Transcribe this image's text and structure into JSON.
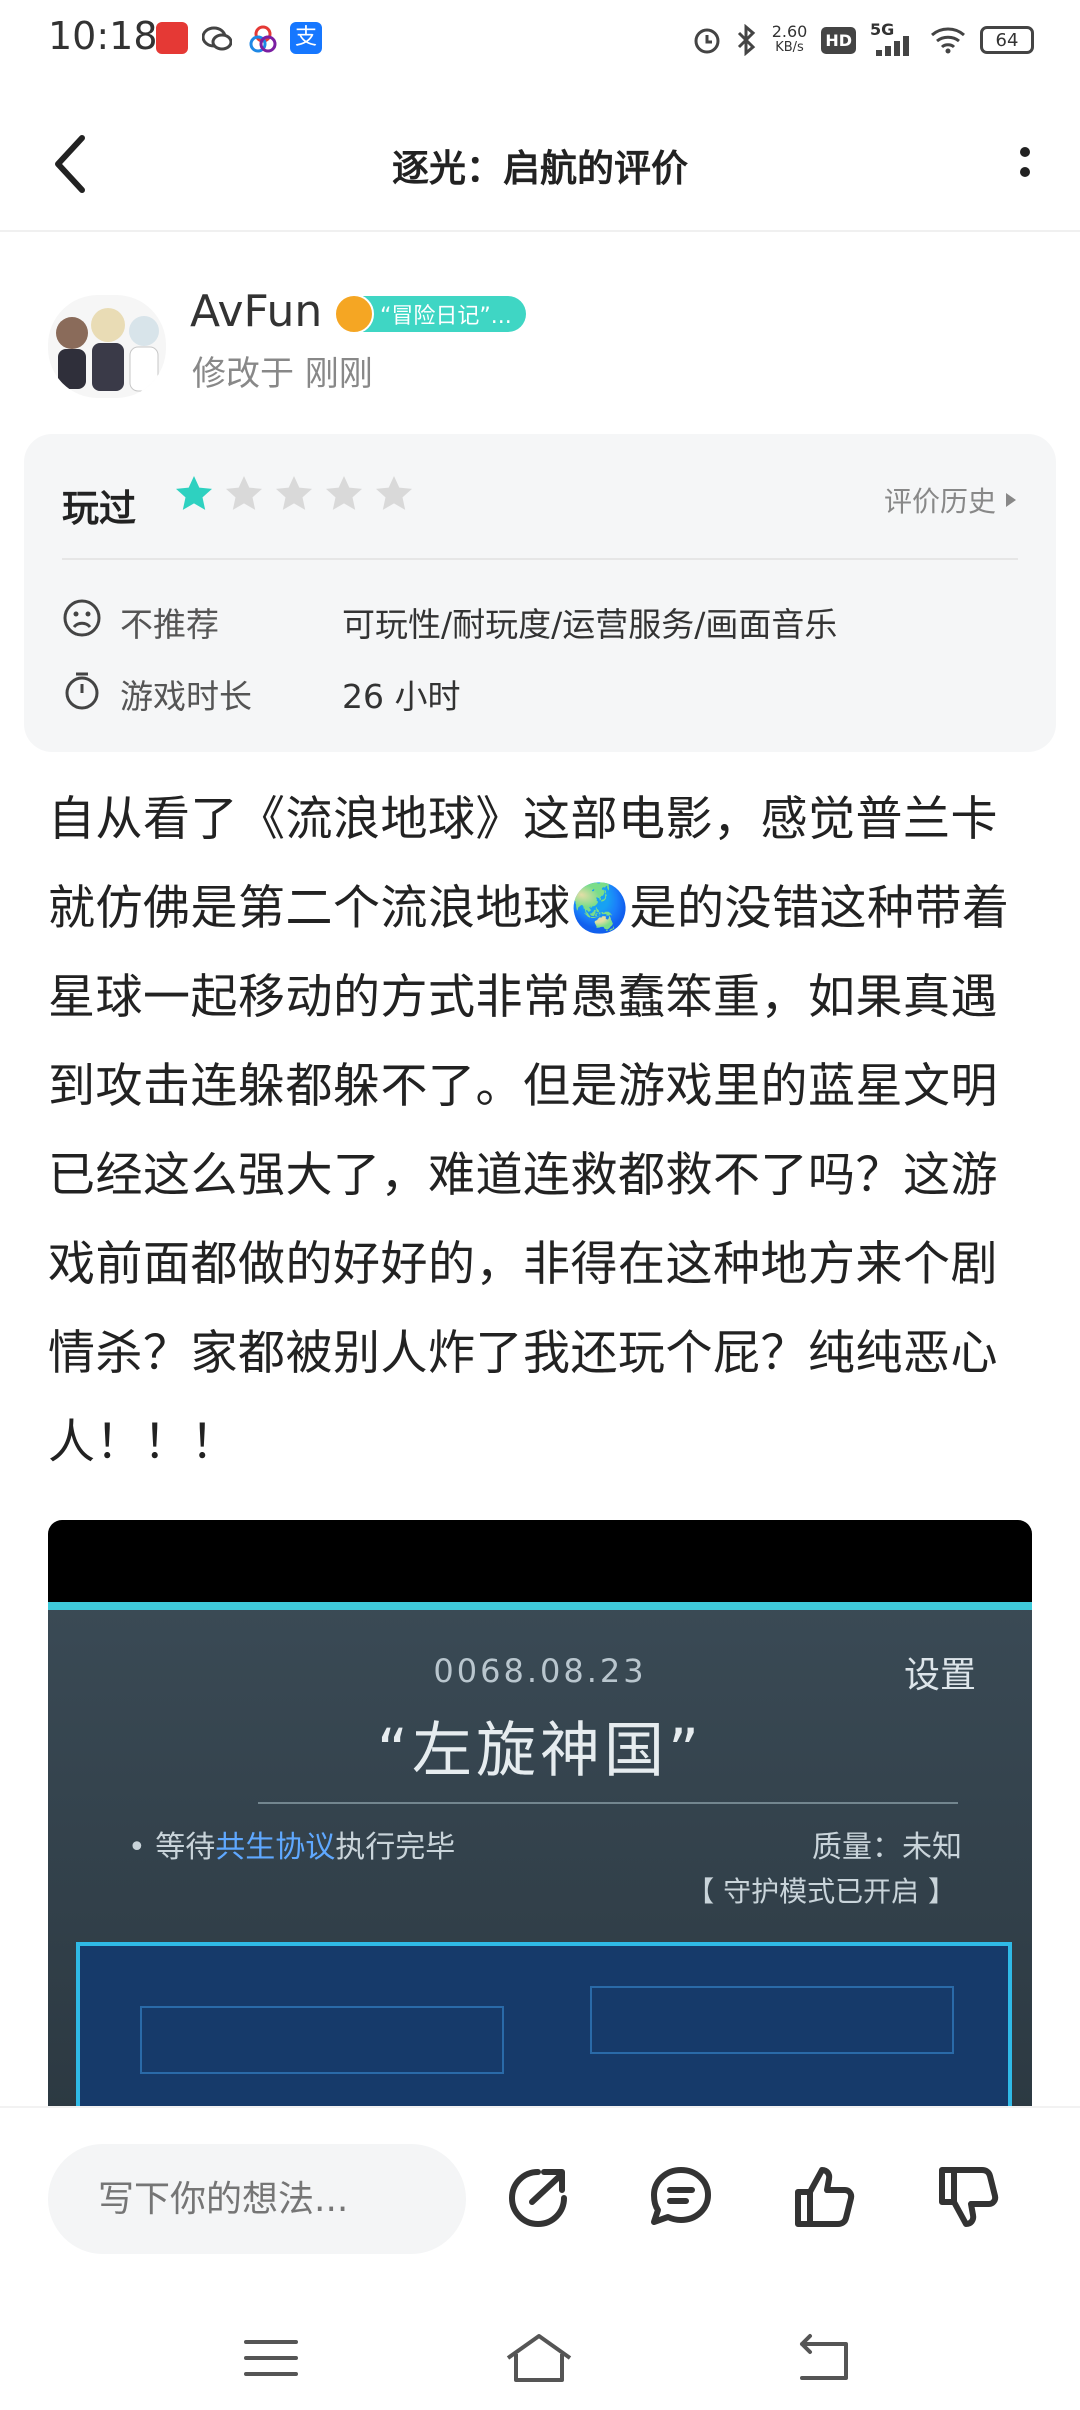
{
  "status_bar": {
    "time": "10:18",
    "network_speed_value": "2.60",
    "network_speed_unit": "KB/s",
    "hd_label": "HD",
    "signal_label": "5G",
    "battery": "64"
  },
  "nav": {
    "title": "逐光：启航的评价"
  },
  "author": {
    "name": "AvFun",
    "badge": "“冒险日记”...",
    "modified": "修改于 刚刚"
  },
  "rating_card": {
    "played_label": "玩过",
    "rating": 1,
    "max_rating": 5,
    "history_label": "评价历史",
    "recommend_label": "不推荐",
    "recommend_value": "可玩性/耐玩度/运营服务/画面音乐",
    "playtime_label": "游戏时长",
    "playtime_value": "26 小时"
  },
  "review": {
    "text": "自从看了《流浪地球》这部电影，感觉普兰卡就仿佛是第二个流浪地球🌏是的没错这种带着星球一起移动的方式非常愚蠢笨重，如果真遇到攻击连躲都躲不了。但是游戏里的蓝星文明已经这么强大了，难道连救都救不了吗？这游戏前面都做的好好的，非得在这种地方来个剧情杀？家都被别人炸了我还玩个屁？纯纯恶心人！！！"
  },
  "image": {
    "date": "0068.08.23",
    "settings": "设置",
    "name": "“左旋神国”",
    "wait_prefix": "• 等待",
    "wait_highlight": "共生协议",
    "wait_suffix": "执行完毕",
    "quality": "质量：未知",
    "guard": "【 守护模式已开启 】"
  },
  "bottom_bar": {
    "comment_placeholder": "写下你的想法..."
  },
  "colors": {
    "accent": "#3fd6c4",
    "star_active": "#2ed1c0",
    "star_inactive": "#d9d9d9"
  }
}
